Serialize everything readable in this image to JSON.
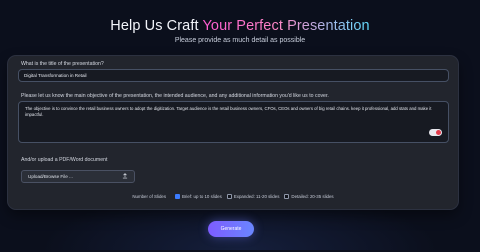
{
  "header": {
    "title_prefix": "Help Us Craft ",
    "title_highlight": "Your Perfect Presentation",
    "subtitle": "Please provide as much detail as possible"
  },
  "form": {
    "title_label": "What is the title of the presentation?",
    "title_value": "Digital Transformation in Retail",
    "objective_label": "Please let us know the main objective of the presentation, the intended audience, and any additional information you'd like us to cover.",
    "objective_text": "The objective is to convince the retail business owners to adopt the digitization. Target audience is the retail business owners, CFOs, CEOs and owners of big retail chains. keep it professional, add stats and make it impactful.",
    "upload_label": "And/or upload a PDF/Word document",
    "upload_button": "Upload/Browse File ..."
  },
  "slides": {
    "label": "Number of Slides",
    "options": [
      {
        "label": "Brief: up to 10 slides",
        "checked": true
      },
      {
        "label": "Expanded: 11-20 slides",
        "checked": false
      },
      {
        "label": "Detailed: 20-35 slides",
        "checked": false
      }
    ]
  },
  "actions": {
    "generate": "Generate"
  },
  "icons": {
    "upload": "upload-icon",
    "toggle": "toggle-icon"
  },
  "colors": {
    "accent_start": "#7d5cff",
    "accent_end": "#6a86ff",
    "highlight_pink": "#ff5bd1",
    "highlight_cyan": "#5fdcff"
  }
}
